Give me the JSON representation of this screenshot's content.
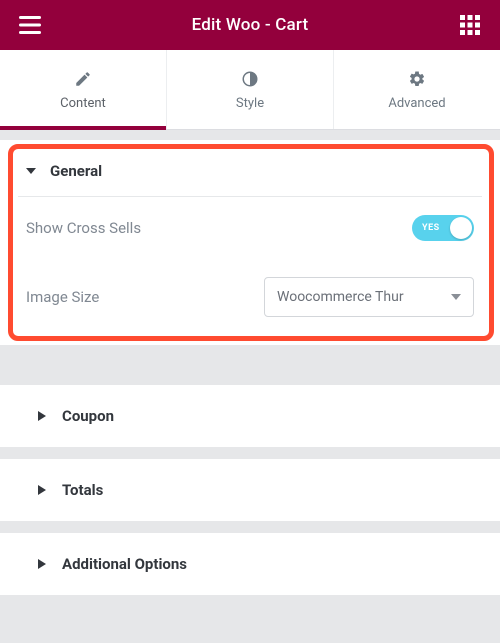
{
  "header": {
    "title": "Edit Woo - Cart"
  },
  "tabs": {
    "content": "Content",
    "style": "Style",
    "advanced": "Advanced"
  },
  "general": {
    "title": "General",
    "show_cross_sells_label": "Show Cross Sells",
    "toggle_text": "YES",
    "image_size_label": "Image Size",
    "image_size_value": "Woocommerce Thur"
  },
  "sections": {
    "coupon": "Coupon",
    "totals": "Totals",
    "additional": "Additional Options"
  }
}
